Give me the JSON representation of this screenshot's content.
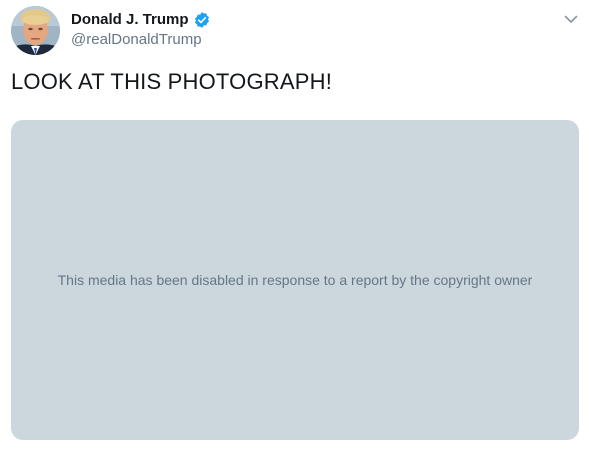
{
  "author": {
    "display_name": "Donald J. Trump",
    "handle": "@realDonaldTrump",
    "verified": true,
    "avatar_icon": "profile-photo-icon"
  },
  "tweet": {
    "text": "LOOK AT THIS PHOTOGRAPH!"
  },
  "media": {
    "message": "This media has been disabled in response to a report by the copyright owner"
  },
  "colors": {
    "verified_blue": "#1da1f2",
    "media_background": "#ccd6dd",
    "secondary_text": "#657786",
    "primary_text": "#14171a"
  },
  "icons": {
    "menu": "chevron-down-icon",
    "verified": "verified-badge-icon"
  }
}
